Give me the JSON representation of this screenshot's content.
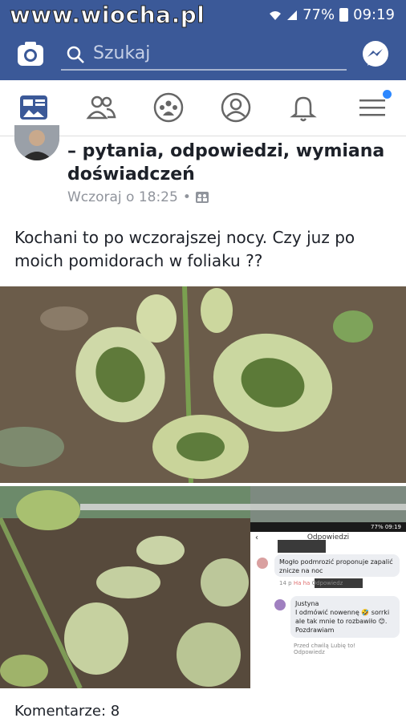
{
  "status": {
    "battery": "77%",
    "time": "09:19"
  },
  "watermark": "www.wiocha.pl",
  "search": {
    "placeholder": "Szukaj"
  },
  "tabs": [
    "news-feed",
    "friends",
    "groups",
    "profile",
    "notifications",
    "menu"
  ],
  "post": {
    "group_title_line1": "– pytania, odpowiedzi, wymiana",
    "group_title_line2": "doświadczeń",
    "timestamp": "Wczoraj o 18:25",
    "separator": "•",
    "text": "Kochani to po wczorajszej nocy. Czy juz po moich pomidorach w foliaku ??"
  },
  "embedded_screenshot": {
    "status": "77% 09:19",
    "title": "Odpowiedzi",
    "reply1_text": "Mogło podmrozić proponuje zapalić znicze na noc",
    "reply1_time": "14 p",
    "reply1_like": "Ha ha",
    "reply1_reply": "Odpowiedz",
    "reply2_name": "Justyna",
    "reply2_text": "I odmówić nowennę 🤣 sorrki ale tak mnie to rozbawiło 😊. Pozdrawiam",
    "reply2_time": "Przed chwilą",
    "reply2_like": "Lubię to!",
    "reply2_reply": "Odpowiedz"
  },
  "comments_label": "Komentarze: 8",
  "colors": {
    "brand": "#3b5998",
    "notification_dot": "#2d88ff"
  }
}
